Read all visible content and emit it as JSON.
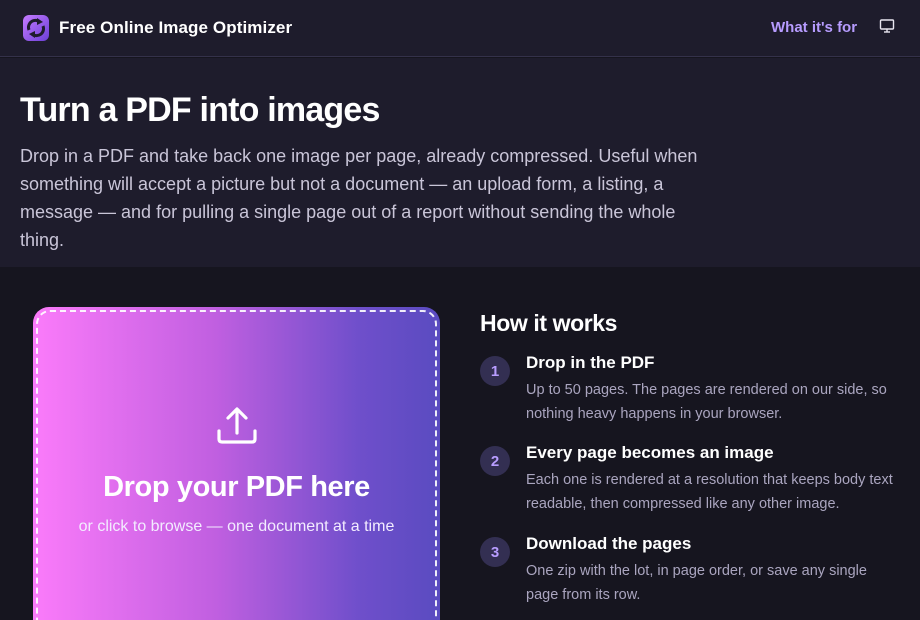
{
  "header": {
    "brand": "Free Online Image Optimizer",
    "nav_link": "What it's for",
    "logo_icon": "refresh-arrows-logo",
    "display_icon": "monitor-icon",
    "accent": "#b79cff"
  },
  "hero": {
    "title": "Turn a PDF into images",
    "description": "Drop in a PDF and take back one image per page, already compressed. Useful when something will accept a picture but not a document — an upload form, a listing, a message — and for pulling a single page out of a report without sending the whole thing."
  },
  "dropzone": {
    "icon": "upload-icon",
    "title": "Drop your PDF here",
    "subtitle": "or click to browse — one document at a time",
    "gradient": [
      "#fb7bfa",
      "#5a4bc0"
    ]
  },
  "how": {
    "title": "How it works",
    "steps": [
      {
        "num": "1",
        "title": "Drop in the PDF",
        "desc": "Up to 50 pages. The pages are rendered on our side, so nothing heavy happens in your browser."
      },
      {
        "num": "2",
        "title": "Every page becomes an image",
        "desc": "Each one is rendered at a resolution that keeps body text readable, then compressed like any other image."
      },
      {
        "num": "3",
        "title": "Download the pages",
        "desc": "One zip with the lot, in page order, or save any single page from its row."
      }
    ]
  }
}
